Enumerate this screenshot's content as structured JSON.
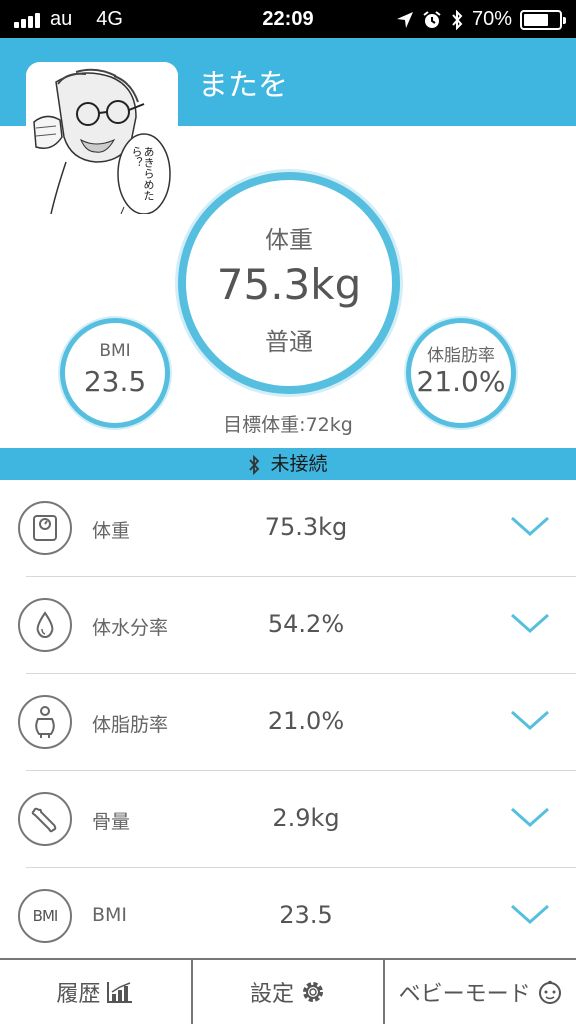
{
  "status_bar": {
    "carrier": "au",
    "network": "4G",
    "time": "22:09",
    "battery": "70%"
  },
  "header": {
    "username": "またを"
  },
  "avatar": {
    "speech_text": "あきらめたら？"
  },
  "main": {
    "weight_label": "体重",
    "weight_value": "75.3kg",
    "weight_status": "普通",
    "bmi_label": "BMI",
    "bmi_value": "23.5",
    "fat_label": "体脂肪率",
    "fat_value": "21.0%",
    "target": "目標体重:72kg"
  },
  "connection": {
    "status": "未接続"
  },
  "metrics": [
    {
      "icon": "scale-icon",
      "label": "体重",
      "value": "75.3kg"
    },
    {
      "icon": "water-drop-icon",
      "label": "体水分率",
      "value": "54.2%"
    },
    {
      "icon": "body-fat-icon",
      "label": "体脂肪率",
      "value": "21.0%"
    },
    {
      "icon": "bone-icon",
      "label": "骨量",
      "value": "2.9kg"
    },
    {
      "icon": "bmi-icon",
      "label": "BMI",
      "value": "23.5",
      "icon_text": "BMI"
    }
  ],
  "tabs": [
    {
      "label": "履歴",
      "icon": "chart-icon"
    },
    {
      "label": "設定",
      "icon": "gear-icon"
    },
    {
      "label": "ベビーモード",
      "icon": "baby-icon"
    }
  ],
  "colors": {
    "accent": "#3fb6e0",
    "ring": "#56bfe0",
    "chevron": "#56bfe0"
  }
}
